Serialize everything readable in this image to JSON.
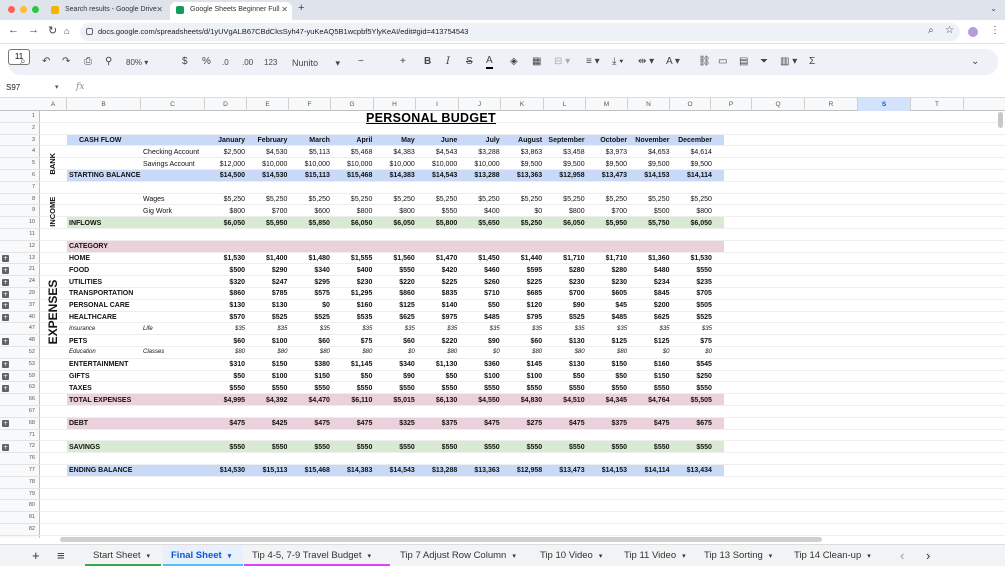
{
  "browser": {
    "tabs": [
      {
        "title": "Search results - Google Drive",
        "icon_color": "#f4b400"
      },
      {
        "title": "Google Sheets Beginner Full",
        "icon_color": "#0f9d58"
      }
    ],
    "url": "docs.google.com/spreadsheets/d/1yUVgALB67CBdCksSyh47-yuKeAQ5B1wcpbf5YlyKeAI/edit#gid=413754543",
    "new_tab": "+"
  },
  "toolbar": {
    "zoom": "80%",
    "currency": "$",
    "percent": "%",
    "dec_less": ".0",
    "dec_more": ".00",
    "format_123": "123",
    "font": "Nunito",
    "font_size": "11",
    "minus": "−",
    "plus": "+",
    "bold": "B",
    "italic": "I",
    "strike": "S",
    "underline_a": "A",
    "text_color_a": "A",
    "functions": "Σ"
  },
  "formula_bar": {
    "cell_ref": "S97",
    "fx": "fx"
  },
  "columns": [
    "A",
    "B",
    "C",
    "D",
    "E",
    "F",
    "G",
    "H",
    "I",
    "J",
    "K",
    "L",
    "M",
    "N",
    "O",
    "P",
    "Q",
    "R",
    "S",
    "T"
  ],
  "selected_column": "S",
  "sheet": {
    "title": "PERSONAL BUDGET",
    "months": [
      "January",
      "February",
      "March",
      "April",
      "May",
      "June",
      "July",
      "August",
      "September",
      "October",
      "November",
      "December"
    ],
    "cash_flow_label": "CASH FLOW",
    "section_labels": {
      "bank": "BANK",
      "income": "INCOME",
      "expenses": "EXPENSES"
    },
    "category_label": "CATEGORY",
    "rows": [
      {
        "r": "1"
      },
      {
        "r": "2"
      },
      {
        "r": "3"
      },
      {
        "r": "4",
        "label_c": "Checking Account",
        "vals": [
          "$2,500",
          "$4,530",
          "$5,113",
          "$5,468",
          "$4,383",
          "$4,543",
          "$3,288",
          "$3,863",
          "$3,458",
          "$3,973",
          "$4,653",
          "$4,614"
        ]
      },
      {
        "r": "5",
        "label_c": "Savings Account",
        "vals": [
          "$12,000",
          "$10,000",
          "$10,000",
          "$10,000",
          "$10,000",
          "$10,000",
          "$10,000",
          "$9,500",
          "$9,500",
          "$9,500",
          "$9,500",
          "$9,500"
        ]
      },
      {
        "r": "6",
        "label_b": "STARTING BALANCE",
        "bold": true,
        "band": "#c9daf8",
        "vals": [
          "$14,500",
          "$14,530",
          "$15,113",
          "$15,468",
          "$14,383",
          "$14,543",
          "$13,288",
          "$13,363",
          "$12,958",
          "$13,473",
          "$14,153",
          "$14,114"
        ]
      },
      {
        "r": "7"
      },
      {
        "r": "8",
        "label_c": "Wages",
        "vals": [
          "$5,250",
          "$5,250",
          "$5,250",
          "$5,250",
          "$5,250",
          "$5,250",
          "$5,250",
          "$5,250",
          "$5,250",
          "$5,250",
          "$5,250",
          "$5,250"
        ]
      },
      {
        "r": "9",
        "label_c": "Gig Work",
        "vals": [
          "$800",
          "$700",
          "$600",
          "$800",
          "$800",
          "$550",
          "$400",
          "$0",
          "$800",
          "$700",
          "$500",
          "$800"
        ]
      },
      {
        "r": "10",
        "label_b": "INFLOWS",
        "bold": true,
        "band": "#d9ead3",
        "vals": [
          "$6,050",
          "$5,950",
          "$5,850",
          "$6,050",
          "$6,050",
          "$5,800",
          "$5,650",
          "$5,250",
          "$6,050",
          "$5,950",
          "$5,750",
          "$6,050"
        ]
      },
      {
        "r": "11"
      },
      {
        "r": "12",
        "label_b": "CATEGORY",
        "bold": true,
        "band": "#ead1dc"
      },
      {
        "r": "13",
        "plus": true,
        "label_b": "HOME",
        "bold": true,
        "vals": [
          "$1,530",
          "$1,400",
          "$1,480",
          "$1,555",
          "$1,560",
          "$1,470",
          "$1,450",
          "$1,440",
          "$1,710",
          "$1,710",
          "$1,360",
          "$1,530"
        ]
      },
      {
        "r": "21",
        "plus": true,
        "label_b": "FOOD",
        "bold": true,
        "vals": [
          "$500",
          "$290",
          "$340",
          "$400",
          "$550",
          "$420",
          "$460",
          "$595",
          "$280",
          "$280",
          "$480",
          "$550"
        ]
      },
      {
        "r": "24",
        "plus": true,
        "label_b": "UTILITIES",
        "bold": true,
        "vals": [
          "$320",
          "$247",
          "$295",
          "$230",
          "$220",
          "$225",
          "$260",
          "$225",
          "$230",
          "$230",
          "$234",
          "$235"
        ]
      },
      {
        "r": "29",
        "plus": true,
        "label_b": "TRANSPORTATION",
        "bold": true,
        "vals": [
          "$860",
          "$785",
          "$575",
          "$1,295",
          "$860",
          "$835",
          "$710",
          "$685",
          "$700",
          "$605",
          "$845",
          "$705"
        ]
      },
      {
        "r": "37",
        "plus": true,
        "label_b": "PERSONAL CARE",
        "bold": true,
        "vals": [
          "$130",
          "$130",
          "$0",
          "$160",
          "$125",
          "$140",
          "$50",
          "$120",
          "$90",
          "$45",
          "$200",
          "$505"
        ]
      },
      {
        "r": "40",
        "plus": true,
        "label_b": "HEALTHCARE",
        "bold": true,
        "vals": [
          "$570",
          "$525",
          "$525",
          "$535",
          "$625",
          "$975",
          "$485",
          "$795",
          "$525",
          "$485",
          "$625",
          "$525"
        ]
      },
      {
        "r": "47",
        "italic": true,
        "label_b": "Insurance",
        "label_c": "Life",
        "vals": [
          "$35",
          "$35",
          "$35",
          "$35",
          "$35",
          "$35",
          "$35",
          "$35",
          "$35",
          "$35",
          "$35",
          "$35"
        ]
      },
      {
        "r": "48",
        "plus": true,
        "label_b": "PETS",
        "bold": true,
        "vals": [
          "$60",
          "$100",
          "$60",
          "$75",
          "$60",
          "$220",
          "$90",
          "$60",
          "$130",
          "$125",
          "$125",
          "$75"
        ]
      },
      {
        "r": "52",
        "italic": true,
        "label_b": "Education",
        "label_c": "Classes",
        "vals": [
          "$80",
          "$80",
          "$80",
          "$80",
          "$0",
          "$80",
          "$0",
          "$80",
          "$80",
          "$80",
          "$0",
          "$0"
        ]
      },
      {
        "r": "53",
        "plus": true,
        "label_b": "ENTERTAINMENT",
        "bold": true,
        "vals": [
          "$310",
          "$150",
          "$380",
          "$1,145",
          "$340",
          "$1,130",
          "$360",
          "$145",
          "$130",
          "$150",
          "$160",
          "$545"
        ]
      },
      {
        "r": "59",
        "plus": true,
        "label_b": "GIFTS",
        "bold": true,
        "vals": [
          "$50",
          "$100",
          "$150",
          "$50",
          "$90",
          "$50",
          "$100",
          "$100",
          "$50",
          "$50",
          "$150",
          "$250"
        ]
      },
      {
        "r": "63",
        "plus": true,
        "label_b": "TAXES",
        "bold": true,
        "vals": [
          "$550",
          "$550",
          "$550",
          "$550",
          "$550",
          "$550",
          "$550",
          "$550",
          "$550",
          "$550",
          "$550",
          "$550"
        ]
      },
      {
        "r": "66",
        "label_b": "TOTAL EXPENSES",
        "bold": true,
        "band": "#ead1dc",
        "vals": [
          "$4,995",
          "$4,392",
          "$4,470",
          "$6,110",
          "$5,015",
          "$6,130",
          "$4,550",
          "$4,830",
          "$4,510",
          "$4,345",
          "$4,764",
          "$5,505"
        ]
      },
      {
        "r": "67"
      },
      {
        "r": "68",
        "plus": true,
        "label_b": "DEBT",
        "bold": true,
        "band": "#ead1dc",
        "vals": [
          "$475",
          "$425",
          "$475",
          "$475",
          "$325",
          "$375",
          "$475",
          "$275",
          "$475",
          "$375",
          "$475",
          "$675"
        ]
      },
      {
        "r": "71"
      },
      {
        "r": "72",
        "plus": true,
        "label_b": "SAVINGS",
        "bold": true,
        "band": "#d9ead3",
        "vals": [
          "$550",
          "$550",
          "$550",
          "$550",
          "$550",
          "$550",
          "$550",
          "$550",
          "$550",
          "$550",
          "$550",
          "$550"
        ]
      },
      {
        "r": "76"
      },
      {
        "r": "77",
        "label_b": "ENDING BALANCE",
        "bold": true,
        "band": "#c9daf8",
        "vals": [
          "$14,530",
          "$15,113",
          "$15,468",
          "$14,383",
          "$14,543",
          "$13,288",
          "$13,363",
          "$12,958",
          "$13,473",
          "$14,153",
          "$14,114",
          "$13,434"
        ]
      },
      {
        "r": "78"
      },
      {
        "r": "79"
      },
      {
        "r": "80"
      },
      {
        "r": "81"
      },
      {
        "r": "82"
      }
    ]
  },
  "sheet_tabs": [
    {
      "name": "Start Sheet",
      "color": "#34a853"
    },
    {
      "name": "Final Sheet",
      "color": "#4fc3f7",
      "active": true
    },
    {
      "name": "Tip 4-5, 7-9 Travel Budget",
      "color": "#e040fb"
    },
    {
      "name": "Tip 7 Adjust Row Column",
      "color": ""
    },
    {
      "name": "Tip 10 Video",
      "color": ""
    },
    {
      "name": "Tip 11 Video",
      "color": ""
    },
    {
      "name": "Tip 13 Sorting",
      "color": ""
    },
    {
      "name": "Tip 14 Clean-up",
      "color": ""
    }
  ],
  "sheet_nav": {
    "add": "+",
    "menu": "≡",
    "prev": "‹",
    "next": "›"
  }
}
